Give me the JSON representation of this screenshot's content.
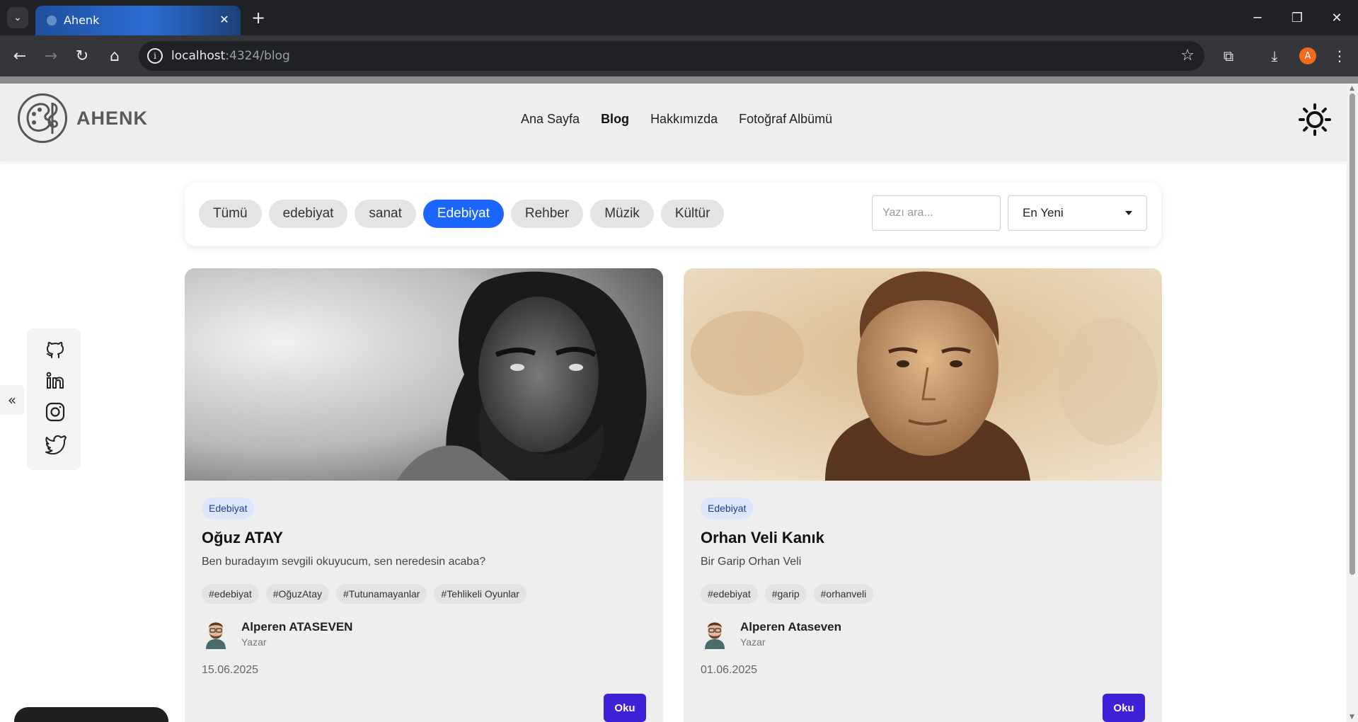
{
  "browser": {
    "tab_title": "Ahenk",
    "url_host": "localhost",
    "url_rest": ":4324/blog",
    "profile_initial": "A"
  },
  "site": {
    "logo_text": "AHENK",
    "nav": [
      "Ana Sayfa",
      "Blog",
      "Hakkımızda",
      "Fotoğraf Albümü"
    ],
    "active_nav": "Blog"
  },
  "filters": {
    "chips": [
      "Tümü",
      "edebiyat",
      "sanat",
      "Edebiyat",
      "Rehber",
      "Müzik",
      "Kültür"
    ],
    "active_chip": "Edebiyat",
    "search_placeholder": "Yazı ara...",
    "sort_value": "En Yeni"
  },
  "social": [
    "github-icon",
    "linkedin-icon",
    "instagram-icon",
    "twitter-icon"
  ],
  "posts": [
    {
      "category": "Edebiyat",
      "title": "Oğuz ATAY",
      "excerpt": "Ben buradayım sevgili okuyucum, sen neredesin acaba?",
      "tags": [
        "#edebiyat",
        "#OğuzAtay",
        "#Tutunamayanlar",
        "#Tehlikeli Oyunlar"
      ],
      "author": "Alperen ATASEVEN",
      "role": "Yazar",
      "date": "15.06.2025",
      "read": "Oku"
    },
    {
      "category": "Edebiyat",
      "title": "Orhan Veli Kanık",
      "excerpt": "Bir Garip Orhan Veli",
      "tags": [
        "#edebiyat",
        "#garip",
        "#orhanveli"
      ],
      "author": "Alperen Ataseven",
      "role": "Yazar",
      "date": "01.06.2025",
      "read": "Oku"
    }
  ],
  "colors": {
    "accent_chip": "#1a66ff",
    "read_button": "#3e21d6",
    "category_badge": "#dbe6fb"
  }
}
